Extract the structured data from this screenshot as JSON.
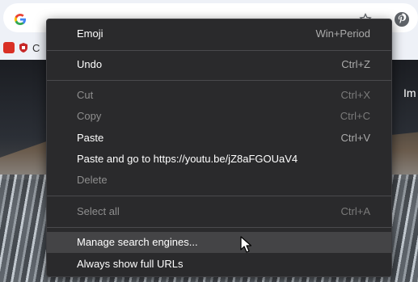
{
  "browser": {
    "bookmarks": [
      {
        "label": "",
        "icon": "bookmark-red-icon",
        "color": "#d93025"
      },
      {
        "label": "C",
        "icon": "bookmark-shield-icon",
        "color": "#c62828"
      }
    ]
  },
  "ntp": {
    "corner_label": "Im"
  },
  "context_menu": {
    "items": [
      {
        "label": "Emoji",
        "accel": "Win+Period",
        "enabled": true
      },
      {
        "label": "Undo",
        "accel": "Ctrl+Z",
        "enabled": true
      },
      {
        "label": "Cut",
        "accel": "Ctrl+X",
        "enabled": false
      },
      {
        "label": "Copy",
        "accel": "Ctrl+C",
        "enabled": false
      },
      {
        "label": "Paste",
        "accel": "Ctrl+V",
        "enabled": true
      },
      {
        "label": "Paste and go to https://youtu.be/jZ8aFGOUaV4",
        "accel": "",
        "enabled": true
      },
      {
        "label": "Delete",
        "accel": "",
        "enabled": false
      },
      {
        "label": "Select all",
        "accel": "Ctrl+A",
        "enabled": false
      },
      {
        "label": "Manage search engines...",
        "accel": "",
        "enabled": true,
        "hovered": true
      },
      {
        "label": "Always show full URLs",
        "accel": "",
        "enabled": true
      }
    ]
  },
  "colors": {
    "menu_bg": "#2a2a2c",
    "menu_hover": "#444446",
    "text": "#ffffff",
    "text_disabled": "#8e8e8e"
  }
}
